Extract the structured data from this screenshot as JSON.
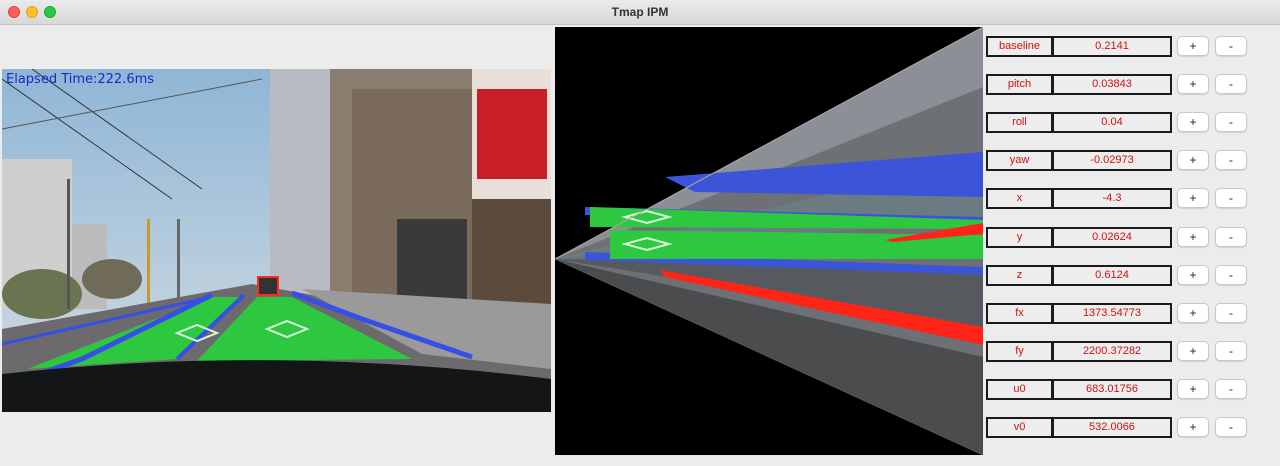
{
  "window": {
    "title": "Tmap IPM"
  },
  "camera_view": {
    "elapsed_text": "Elapsed Time:222.6ms"
  },
  "buttons": {
    "plus": "+",
    "minus": "-"
  },
  "params": [
    {
      "label": "baseline",
      "value": "0.2141"
    },
    {
      "label": "pitch",
      "value": "0.03843"
    },
    {
      "label": "roll",
      "value": "0.04"
    },
    {
      "label": "yaw",
      "value": "-0.02973"
    },
    {
      "label": "x",
      "value": "-4.3"
    },
    {
      "label": "y",
      "value": "0.02624"
    },
    {
      "label": "z",
      "value": "0.6124"
    },
    {
      "label": "fx",
      "value": "1373.54773"
    },
    {
      "label": "fy",
      "value": "2200.37282"
    },
    {
      "label": "u0",
      "value": "683.01756"
    },
    {
      "label": "v0",
      "value": "532.0066"
    }
  ],
  "colors": {
    "lane_fill": "#2ec840",
    "lane_edge": "#3450e6",
    "stop_line": "#ff2418",
    "param_text": "#cc1111",
    "elapsed_text": "#1a28c8"
  }
}
